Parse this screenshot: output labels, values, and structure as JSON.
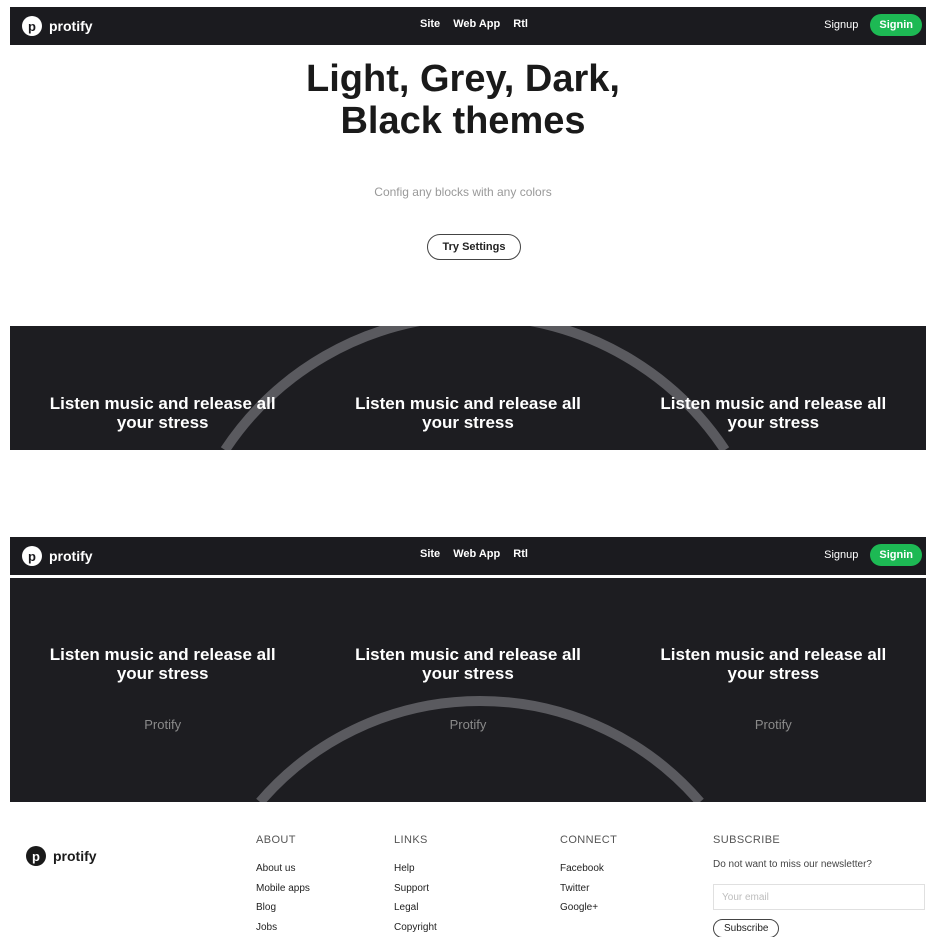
{
  "nav": {
    "brand": "protify",
    "logo_letter": "p",
    "links": [
      "Site",
      "Web App",
      "Rtl"
    ],
    "signup_label": "Signup",
    "signin_label": "Signin"
  },
  "hero": {
    "title_line1": "Light, Grey, Dark,",
    "title_line2": "Black themes",
    "subtitle": "Config any blocks with any colors",
    "button_label": "Try Settings"
  },
  "band_top": {
    "cards": [
      {
        "title_line1": "Listen music and release all",
        "title_line2": "your stress"
      },
      {
        "title_line1": "Listen music and release all",
        "title_line2": "your stress"
      },
      {
        "title_line1": "Listen music and release all",
        "title_line2": "your stress"
      }
    ]
  },
  "band_bottom": {
    "cards": [
      {
        "title_line1": "Listen music and release all",
        "title_line2": "your stress",
        "sub": "Protify"
      },
      {
        "title_line1": "Listen music and release all",
        "title_line2": "your stress",
        "sub": "Protify"
      },
      {
        "title_line1": "Listen music and release all",
        "title_line2": "your stress",
        "sub": "Protify"
      }
    ]
  },
  "footer": {
    "brand": "protify",
    "logo_letter": "p",
    "about": {
      "heading": "ABOUT",
      "links": [
        "About us",
        "Mobile apps",
        "Blog",
        "Jobs"
      ]
    },
    "links": {
      "heading": "LINKS",
      "links": [
        "Help",
        "Support",
        "Legal",
        "Copyright"
      ]
    },
    "connect": {
      "heading": "CONNECT",
      "links": [
        "Facebook",
        "Twitter",
        "Google+"
      ]
    },
    "subscribe": {
      "heading": "SUBSCRIBE",
      "note": "Do not want to miss our newsletter?",
      "placeholder": "Your email",
      "button_label": "Subscribe"
    }
  },
  "colors": {
    "accent": "#1db954",
    "dark": "#1d1d21"
  }
}
